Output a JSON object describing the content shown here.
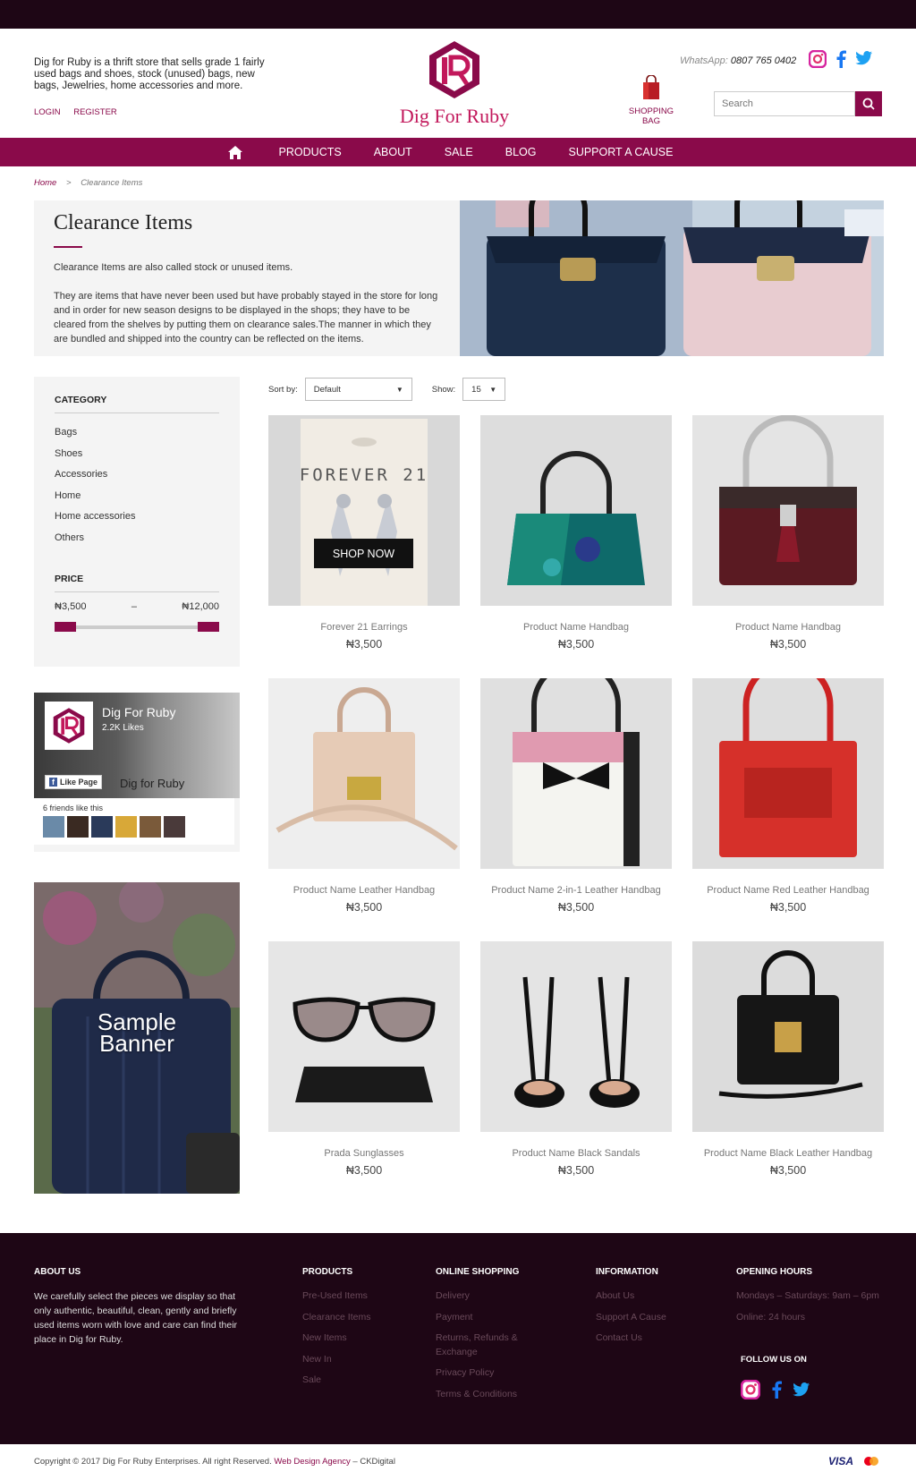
{
  "header": {
    "tagline": "Dig for Ruby is a thrift store that sells grade 1 fairly used bags and shoes, stock (unused) bags, new bags, Jewelries, home accessories and more.",
    "login": "LOGIN",
    "register": "REGISTER",
    "brand": "Dig For Ruby",
    "whatsapp_label": "WhatsApp:",
    "whatsapp_number": "0807 765 0402",
    "cart_label": "SHOPPING BAG",
    "search_placeholder": "Search",
    "social_icons": [
      "instagram-icon",
      "facebook-icon",
      "twitter-icon"
    ]
  },
  "nav": {
    "items": [
      "PRODUCTS",
      "ABOUT",
      "SALE",
      "BLOG",
      "SUPPORT A CAUSE"
    ]
  },
  "breadcrumb": {
    "home": "Home",
    "separator": ">",
    "current": "Clearance Items"
  },
  "intro": {
    "title": "Clearance Items",
    "p1": "Clearance Items are also called stock or unused items.",
    "p2": "They are items that have never been used but have probably stayed in the store for long and in order for new season designs to be displayed in the shops; they have to be cleared from the shelves by putting them on clearance sales.The manner in which they are bundled and shipped into the country can be reflected on the items."
  },
  "sidebar": {
    "category_heading": "CATEGORY",
    "categories": [
      "Bags",
      "Shoes",
      "Accessories",
      "Home",
      "Home accessories",
      "Others"
    ],
    "price_heading": "PRICE",
    "price_min": "₦3,500",
    "price_dash": "–",
    "price_max": "₦12,000"
  },
  "facebook": {
    "page_title": "Dig For Ruby",
    "likes": "2.2K Likes",
    "like_button": "Like Page",
    "page_name": "Dig for Ruby",
    "friends": "6 friends like this"
  },
  "banner": {
    "line1": "Sample",
    "line2": "Banner"
  },
  "toolbar": {
    "sort_label": "Sort by:",
    "sort_value": "Default",
    "show_label": "Show:",
    "show_value": "15"
  },
  "products": [
    {
      "name": "Forever 21 Earrings",
      "price": "₦3,500",
      "image_text": "FOREVER 21",
      "overlay": "SHOP NOW"
    },
    {
      "name": "Product Name Handbag",
      "price": "₦3,500"
    },
    {
      "name": "Product Name Handbag",
      "price": "₦3,500"
    },
    {
      "name": "Product Name Leather Handbag",
      "price": "₦3,500"
    },
    {
      "name": "Product Name 2-in-1 Leather Handbag",
      "price": "₦3,500"
    },
    {
      "name": "Product Name Red Leather Handbag",
      "price": "₦3,500"
    },
    {
      "name": "Prada Sunglasses",
      "price": "₦3,500"
    },
    {
      "name": "Product Name Black Sandals",
      "price": "₦3,500"
    },
    {
      "name": "Product Name Black Leather Handbag",
      "price": "₦3,500"
    }
  ],
  "footer": {
    "about_heading": "ABOUT US",
    "about_text": "We carefully select the pieces we display so that only authentic, beautiful, clean, gently and briefly used items worn with love and care can find their place in Dig for Ruby.",
    "products_heading": "PRODUCTS",
    "products_links": [
      "Pre-Used Items",
      "Clearance Items",
      "New Items",
      "New In",
      "Sale"
    ],
    "shopping_heading": "ONLINE SHOPPING",
    "shopping_links": [
      "Delivery",
      "Payment",
      "Returns, Refunds & Exchange",
      "Privacy Policy",
      "Terms & Conditions"
    ],
    "info_heading": "INFORMATION",
    "info_links": [
      "About Us",
      "Support A Cause",
      "Contact Us"
    ],
    "hours_heading": "OPENING HOURS",
    "hours": [
      "Mondays – Saturdays: 9am – 6pm",
      "Online: 24 hours"
    ],
    "follow": "FOLLOW US ON"
  },
  "copyright": {
    "text": "Copyright © 2017 Dig For Ruby Enterprises. All right Reserved.",
    "agency_link": "Web Design Agency",
    "dash": "–",
    "agency": "CKDigital",
    "visa": "VISA"
  },
  "colors": {
    "brand": "#8a0a4a",
    "dark": "#1e0615",
    "accent_pink": "#c2185b"
  }
}
